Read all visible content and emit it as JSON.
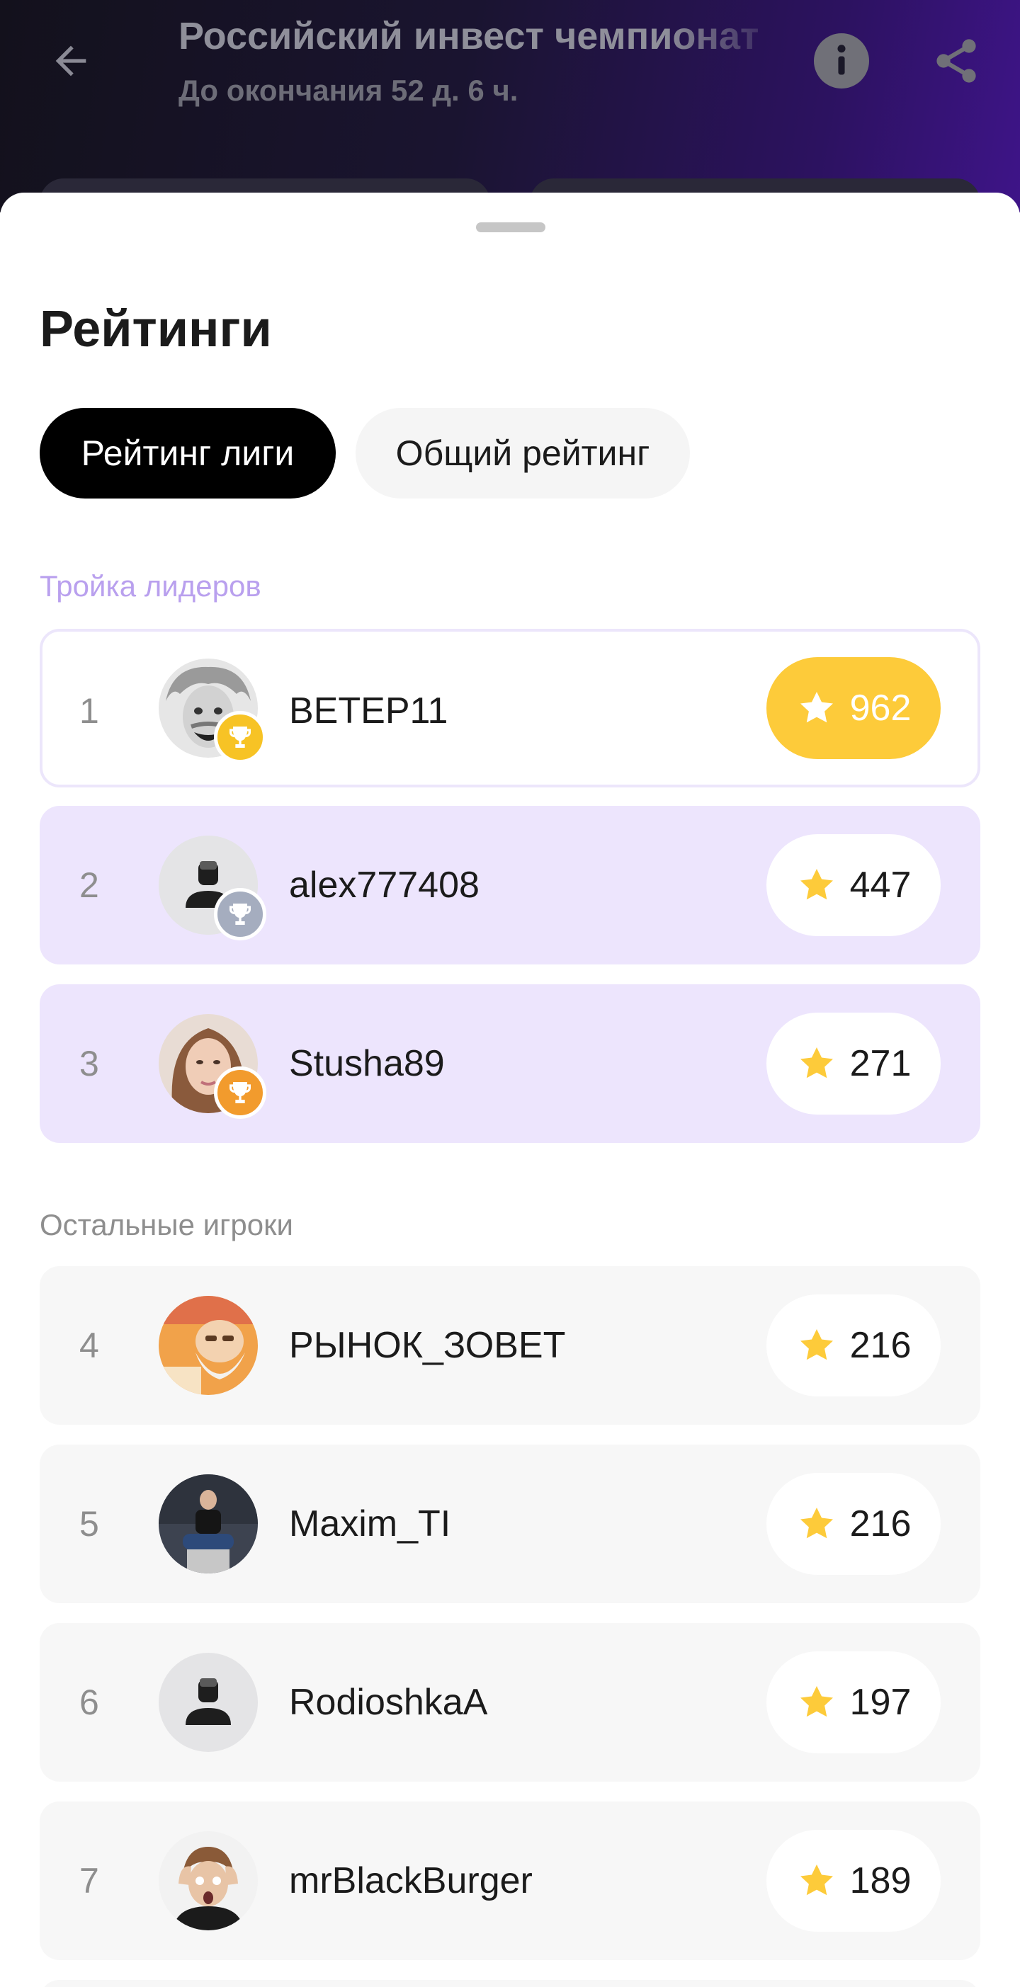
{
  "header": {
    "title": "Российский инвест чемпионат",
    "subtitle": "До окончания 52 д. 6 ч."
  },
  "sheet": {
    "title": "Рейтинги",
    "tabs": [
      {
        "label": "Рейтинг лиги",
        "active": true
      },
      {
        "label": "Общий рейтинг",
        "active": false
      }
    ],
    "leaders_label": "Тройка лидеров",
    "others_label": "Остальные игроки"
  },
  "leaders": [
    {
      "rank": "1",
      "name": "ВЕТЕР11",
      "score": "962",
      "trophy": "gold"
    },
    {
      "rank": "2",
      "name": "alex777408",
      "score": "447",
      "trophy": "silver"
    },
    {
      "rank": "3",
      "name": "Stusha89",
      "score": "271",
      "trophy": "bronze"
    }
  ],
  "players": [
    {
      "rank": "4",
      "name": "РЫНОК_ЗОВЕТ",
      "score": "216"
    },
    {
      "rank": "5",
      "name": "Maxim_TI",
      "score": "216"
    },
    {
      "rank": "6",
      "name": "RodioshkaA",
      "score": "197"
    },
    {
      "rank": "7",
      "name": "mrBlackBurger",
      "score": "189"
    }
  ],
  "colors": {
    "accent_gold": "#fdcb3a",
    "leader_bg": "#ede5fd",
    "trophy_gold": "#f7c325",
    "trophy_silver": "#a5adbf",
    "trophy_bronze": "#f29b2d"
  },
  "icons": {
    "back": "arrow-left-icon",
    "info": "info-icon",
    "share": "share-icon",
    "star": "star-icon",
    "trophy": "trophy-icon"
  }
}
